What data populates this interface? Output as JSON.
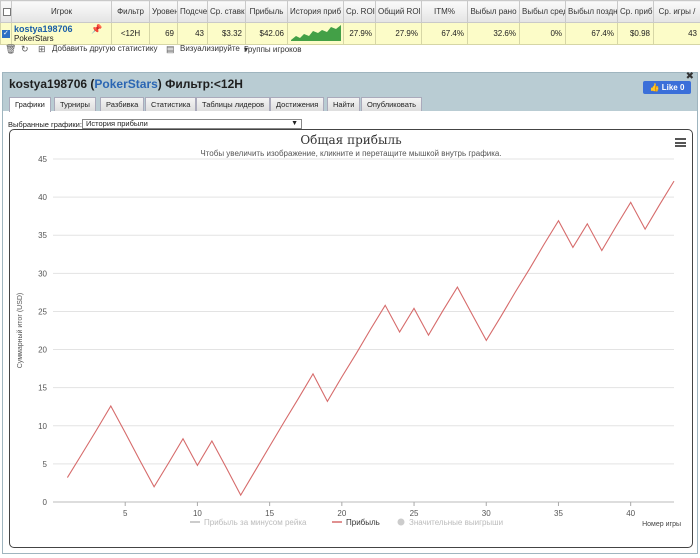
{
  "stats": {
    "columns": [
      "",
      "Игрок",
      "Фильтр",
      "Уровень",
      "Подсчет",
      "Ср. ставк",
      "Прибыль",
      "История приб",
      "Ср. ROI",
      "Общий ROI",
      "ITM%",
      "Выбыл рано",
      "Выбыл сред",
      "Выбыл поздн",
      "Ср. приб",
      "Ср. игры /"
    ],
    "row": {
      "player": "kostya198706",
      "site": "PokerStars",
      "filter": "<12H",
      "level": "69",
      "count": "43",
      "avg_stake": "$3.32",
      "profit": "$42.06",
      "avg_roi": "27.9%",
      "total_roi": "27.9%",
      "itm": "67.4%",
      "early": "32.6%",
      "mid": "0%",
      "late": "67.4%",
      "avg_profit": "$0.98",
      "avg_games": "43"
    }
  },
  "toolbar": {
    "add_stats": "Добавить другую статистику",
    "visualize": "Визуализируйте",
    "groups": "Группы игроков"
  },
  "panel": {
    "player": "kostya198706",
    "site": "PokerStars",
    "filter": "Фильтр:<12H",
    "like": "Like 0",
    "tabs": [
      "Графики",
      "Турниры",
      "Разбивка",
      "Статистика",
      "Таблицы лидеров",
      "Достижения",
      "Найти",
      "Опубликовать"
    ],
    "select_label": "Выбранные графики:",
    "select_value": "История прибыли"
  },
  "chart_data": {
    "type": "line",
    "title": "Общая прибыль",
    "subtitle": "Чтобы увеличить изображение, кликните и перетащите мышкой внутрь графика.",
    "ylabel": "Суммарный итог (USD)",
    "xlabel": "Номер игры",
    "ylim": [
      0,
      45
    ],
    "yticks": [
      0,
      5,
      10,
      15,
      20,
      25,
      30,
      35,
      40,
      45
    ],
    "xlim": [
      0,
      43
    ],
    "xticks": [
      5,
      10,
      15,
      20,
      25,
      30,
      35,
      40
    ],
    "grid": "horizontal",
    "legend_position": "bottom",
    "legend": [
      "Прибыль за минусом рейка",
      "Прибыль",
      "Значительные выигрыши"
    ],
    "series": [
      {
        "name": "Прибыль",
        "color": "#d66b6b",
        "x": [
          1,
          2,
          3,
          4,
          5,
          6,
          7,
          8,
          9,
          10,
          11,
          12,
          13,
          14,
          15,
          16,
          17,
          18,
          19,
          20,
          21,
          22,
          23,
          24,
          25,
          26,
          27,
          28,
          29,
          30,
          31,
          32,
          33,
          34,
          35,
          36,
          37,
          38,
          39,
          40,
          41,
          42,
          43
        ],
        "y": [
          3.2,
          6.3,
          9.4,
          12.6,
          9.1,
          5.5,
          2.0,
          5.1,
          8.3,
          4.8,
          8.0,
          4.5,
          0.9,
          4.1,
          7.3,
          10.5,
          13.6,
          16.8,
          13.2,
          16.4,
          19.5,
          22.7,
          25.8,
          22.3,
          25.4,
          21.9,
          25.1,
          28.2,
          24.7,
          21.2,
          24.3,
          27.5,
          30.6,
          33.8,
          36.9,
          33.4,
          36.5,
          33.0,
          36.2,
          39.3,
          35.8,
          39.0,
          42.1
        ]
      }
    ]
  }
}
